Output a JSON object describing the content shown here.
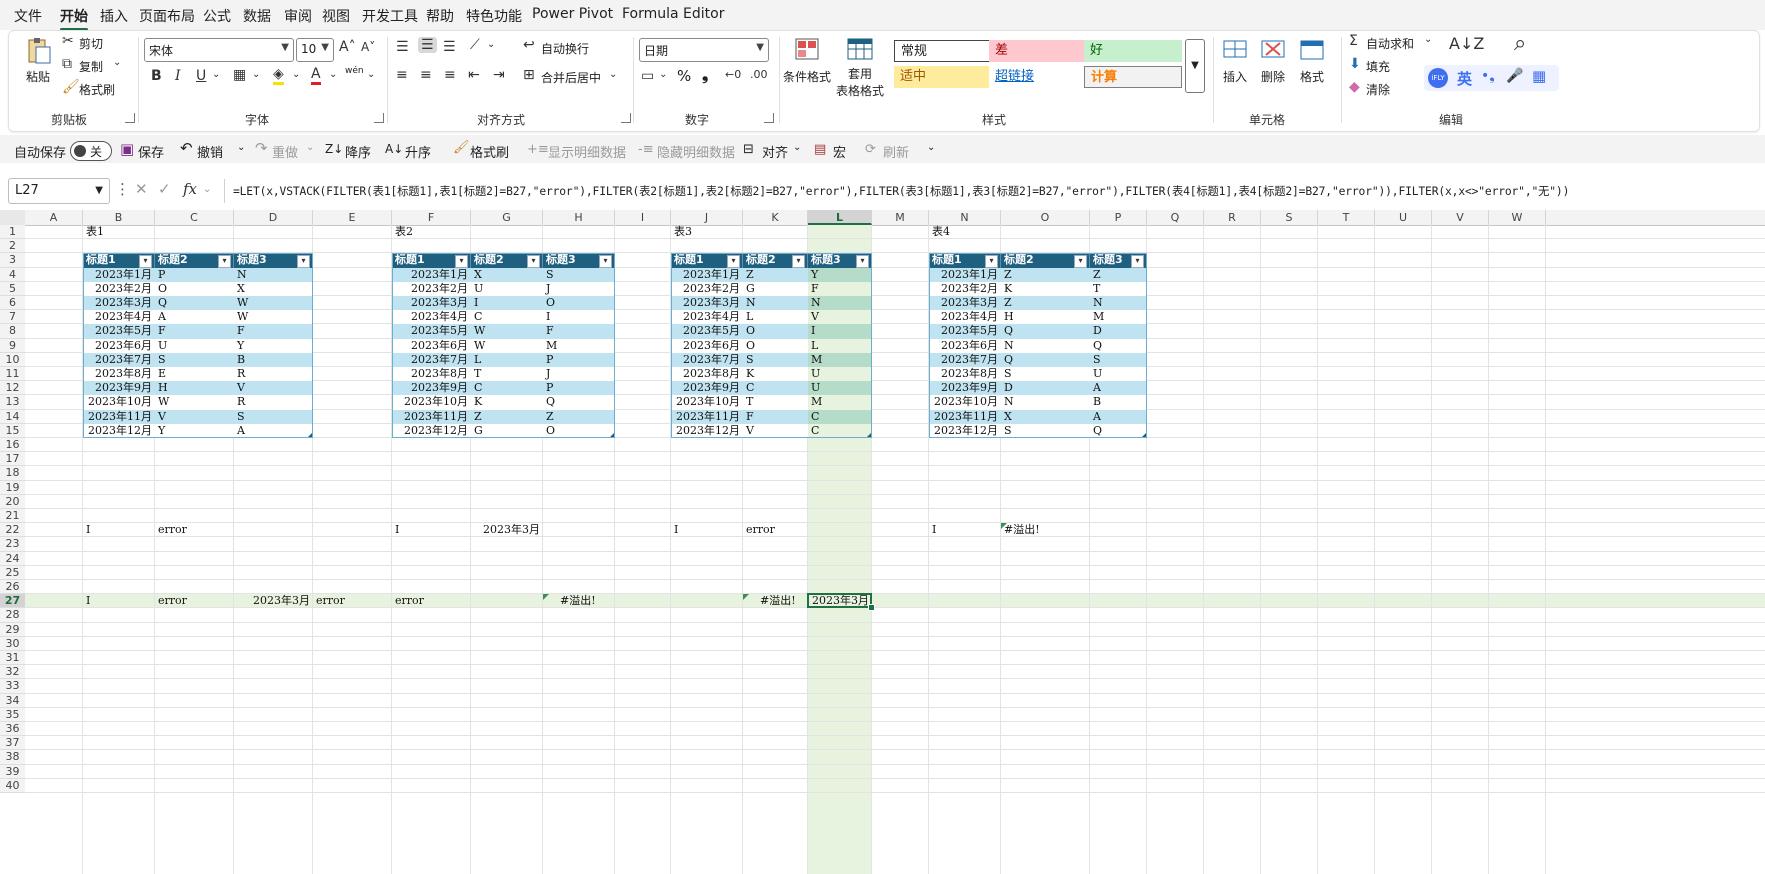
{
  "menu": [
    "文件",
    "开始",
    "插入",
    "页面布局",
    "公式",
    "数据",
    "审阅",
    "视图",
    "开发工具",
    "帮助",
    "特色功能",
    "Power Pivot",
    "Formula Editor"
  ],
  "ribbon": {
    "clipboard": {
      "paste": "粘贴",
      "cut": "剪切",
      "copy": "复制",
      "format_painter": "格式刷",
      "label": "剪贴板"
    },
    "font": {
      "name": "宋体",
      "size": "10",
      "label": "字体",
      "wen": "wén"
    },
    "alignment": {
      "wrap": "自动换行",
      "merge": "合并后居中",
      "label": "对齐方式"
    },
    "number": {
      "format": "日期",
      "percent": "%",
      "comma": "❟",
      "label": "数字"
    },
    "styles": {
      "conditional": "条件格式",
      "table_format_1": "套用",
      "table_format_2": "表格格式",
      "normal": "常规",
      "bad": "差",
      "good": "好",
      "neutral": "适中",
      "hyperlink": "超链接",
      "calc": "计算",
      "label": "样式"
    },
    "cells": {
      "insert": "插入",
      "delete": "删除",
      "format": "格式",
      "label": "单元格"
    },
    "editing": {
      "autosum": "自动求和",
      "fill": "填充",
      "clear": "清除",
      "label": "编辑",
      "ime_lang": "英"
    }
  },
  "qat": {
    "autosave": "自动保存",
    "toggle": "关",
    "save": "保存",
    "undo": "撤销",
    "redo": "重做",
    "sort_desc": "降序",
    "sort_asc": "升序",
    "format_painter": "格式刷",
    "show_detail": "显示明细数据",
    "hide_detail": "隐藏明细数据",
    "align": "对齐",
    "macro": "宏",
    "refresh": "刷新"
  },
  "formula_bar": {
    "name_box": "L27",
    "fx": "fx",
    "formula": "=LET(x,VSTACK(FILTER(表1[标题1],表1[标题2]=B27,\"error\"),FILTER(表2[标题1],表2[标题2]=B27,\"error\"),FILTER(表3[标题1],表3[标题2]=B27,\"error\"),FILTER(表4[标题1],表4[标题2]=B27,\"error\")),FILTER(x,x<>\"error\",\"无\"))"
  },
  "columns": [
    "A",
    "B",
    "C",
    "D",
    "E",
    "F",
    "G",
    "H",
    "I",
    "J",
    "K",
    "L",
    "M",
    "N",
    "O",
    "P",
    "Q",
    "R",
    "S",
    "T",
    "U",
    "V",
    "W"
  ],
  "selected_column": "L",
  "selected_row": 27,
  "row_count": 40,
  "table_headers": [
    "标题1",
    "标题2",
    "标题3"
  ],
  "tables": [
    {
      "title": "表1",
      "rows": [
        [
          "2023年1月",
          "P",
          "N"
        ],
        [
          "2023年2月",
          "O",
          "X"
        ],
        [
          "2023年3月",
          "Q",
          "W"
        ],
        [
          "2023年4月",
          "A",
          "W"
        ],
        [
          "2023年5月",
          "F",
          "F"
        ],
        [
          "2023年6月",
          "U",
          "Y"
        ],
        [
          "2023年7月",
          "S",
          "B"
        ],
        [
          "2023年8月",
          "E",
          "R"
        ],
        [
          "2023年9月",
          "H",
          "V"
        ],
        [
          "2023年10月",
          "W",
          "R"
        ],
        [
          "2023年11月",
          "V",
          "S"
        ],
        [
          "2023年12月",
          "Y",
          "A"
        ]
      ]
    },
    {
      "title": "表2",
      "rows": [
        [
          "2023年1月",
          "X",
          "S"
        ],
        [
          "2023年2月",
          "U",
          "J"
        ],
        [
          "2023年3月",
          "I",
          "O"
        ],
        [
          "2023年4月",
          "C",
          "I"
        ],
        [
          "2023年5月",
          "W",
          "F"
        ],
        [
          "2023年6月",
          "W",
          "M"
        ],
        [
          "2023年7月",
          "L",
          "P"
        ],
        [
          "2023年8月",
          "T",
          "J"
        ],
        [
          "2023年9月",
          "C",
          "P"
        ],
        [
          "2023年10月",
          "K",
          "Q"
        ],
        [
          "2023年11月",
          "Z",
          "Z"
        ],
        [
          "2023年12月",
          "G",
          "O"
        ]
      ]
    },
    {
      "title": "表3",
      "rows": [
        [
          "2023年1月",
          "Z",
          "Y"
        ],
        [
          "2023年2月",
          "G",
          "F"
        ],
        [
          "2023年3月",
          "N",
          "N"
        ],
        [
          "2023年4月",
          "L",
          "V"
        ],
        [
          "2023年5月",
          "O",
          "I"
        ],
        [
          "2023年6月",
          "O",
          "L"
        ],
        [
          "2023年7月",
          "S",
          "M"
        ],
        [
          "2023年8月",
          "K",
          "U"
        ],
        [
          "2023年9月",
          "C",
          "U"
        ],
        [
          "2023年10月",
          "T",
          "M"
        ],
        [
          "2023年11月",
          "F",
          "C"
        ],
        [
          "2023年12月",
          "V",
          "C"
        ]
      ]
    },
    {
      "title": "表4",
      "rows": [
        [
          "2023年1月",
          "Z",
          "Z"
        ],
        [
          "2023年2月",
          "K",
          "T"
        ],
        [
          "2023年3月",
          "Z",
          "N"
        ],
        [
          "2023年4月",
          "H",
          "M"
        ],
        [
          "2023年5月",
          "Q",
          "D"
        ],
        [
          "2023年6月",
          "N",
          "Q"
        ],
        [
          "2023年7月",
          "Q",
          "S"
        ],
        [
          "2023年8月",
          "S",
          "U"
        ],
        [
          "2023年9月",
          "D",
          "A"
        ],
        [
          "2023年10月",
          "N",
          "B"
        ],
        [
          "2023年11月",
          "X",
          "A"
        ],
        [
          "2023年12月",
          "S",
          "Q"
        ]
      ]
    }
  ],
  "row22": [
    {
      "col": "B",
      "text": "I"
    },
    {
      "col": "C",
      "text": "error"
    },
    {
      "col": "F",
      "text": "I"
    },
    {
      "col": "G",
      "text": "2023年3月",
      "align": "right"
    },
    {
      "col": "J",
      "text": "I"
    },
    {
      "col": "K",
      "text": "error"
    },
    {
      "col": "N",
      "text": "I"
    },
    {
      "col": "O",
      "text": "#溢出!"
    }
  ],
  "row27": [
    {
      "col": "B",
      "text": "I"
    },
    {
      "col": "C",
      "text": "error"
    },
    {
      "col": "D",
      "text": "2023年3月",
      "align": "right"
    },
    {
      "col": "E",
      "text": "error"
    },
    {
      "col": "F",
      "text": "error"
    },
    {
      "col": "H",
      "text": "#溢出!"
    },
    {
      "col": "K",
      "text": "#溢出!"
    },
    {
      "col": "L",
      "text": "2023年3月",
      "align": "right"
    }
  ]
}
